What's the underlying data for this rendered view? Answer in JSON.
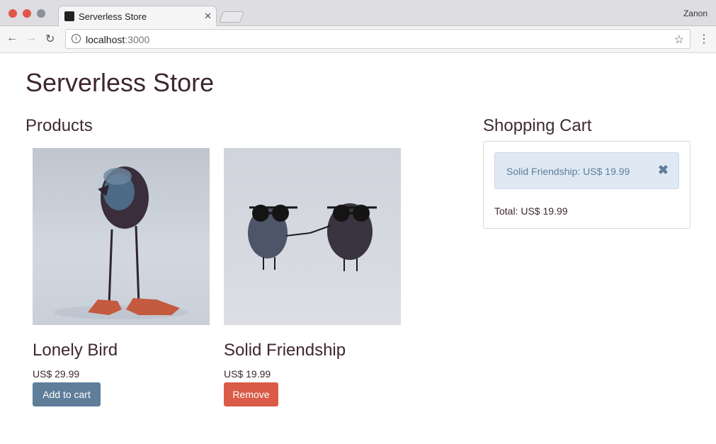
{
  "browser": {
    "tab_title": "Serverless Store",
    "tab_close": "✕",
    "profile_name": "Zanon",
    "url_host": "localhost",
    "url_port": ":3000",
    "icons": [
      "back-arrow-icon",
      "forward-arrow-icon",
      "reload-icon",
      "info-icon",
      "star-icon",
      "menu-icon"
    ]
  },
  "page": {
    "title": "Serverless Store"
  },
  "products": {
    "heading": "Products",
    "items": [
      {
        "name": "Lonely Bird",
        "price": "US$ 29.99",
        "action_label": "Add to cart",
        "action_color": "#5f7e99"
      },
      {
        "name": "Solid Friendship",
        "price": "US$ 19.99",
        "action_label": "Remove",
        "action_color": "#d95b48"
      }
    ]
  },
  "cart": {
    "heading": "Shopping Cart",
    "items": [
      {
        "label": "Solid Friendship: US$ 19.99"
      }
    ],
    "total": "Total: US$ 19.99",
    "accent": "#dfe9f3"
  }
}
